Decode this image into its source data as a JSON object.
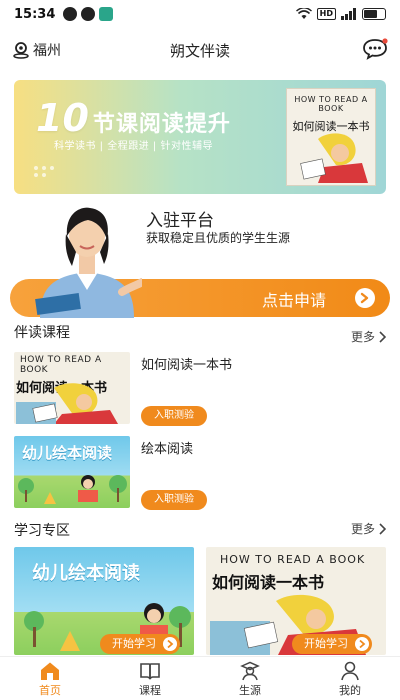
{
  "status_bar": {
    "time": "15:34",
    "network": "HD",
    "signal": "4G"
  },
  "header": {
    "location": "福州",
    "title": "朔文伴读"
  },
  "banner": {
    "number": "10",
    "title": "节课阅读提升",
    "subtitle": "科学读书 | 全程跟进 | 针对性辅导",
    "book_cover_top": "HOW TO READ A BOOK",
    "book_cover_cn": "如何阅读一本书"
  },
  "recruit": {
    "title": "入驻平台",
    "subtitle": "获取稳定且优质的学生生源",
    "apply_label": "点击申请"
  },
  "courses_section": {
    "title": "伴读课程",
    "more_label": "更多",
    "items": [
      {
        "name": "如何阅读一本书",
        "button": "入职测验",
        "cover_top": "HOW TO READ A BOOK",
        "cover_cn": "如何阅读一本书"
      },
      {
        "name": "绘本阅读",
        "button": "入职测验",
        "cover_cn": "幼儿绘本阅读"
      }
    ]
  },
  "study_section": {
    "title": "学习专区",
    "more_label": "更多",
    "items": [
      {
        "cover_cn": "幼儿绘本阅读",
        "button": "开始学习"
      },
      {
        "cover_top": "HOW TO READ A BOOK",
        "cover_cn": "如何阅读一本书",
        "button": "开始学习"
      }
    ]
  },
  "tabbar": {
    "items": [
      {
        "label": "首页",
        "active": true
      },
      {
        "label": "课程",
        "active": false
      },
      {
        "label": "生源",
        "active": false
      },
      {
        "label": "我的",
        "active": false
      }
    ]
  },
  "colors": {
    "accent": "#f08a1d",
    "banner_yellow": "#f7df82",
    "banner_teal": "#9fd6d6"
  }
}
